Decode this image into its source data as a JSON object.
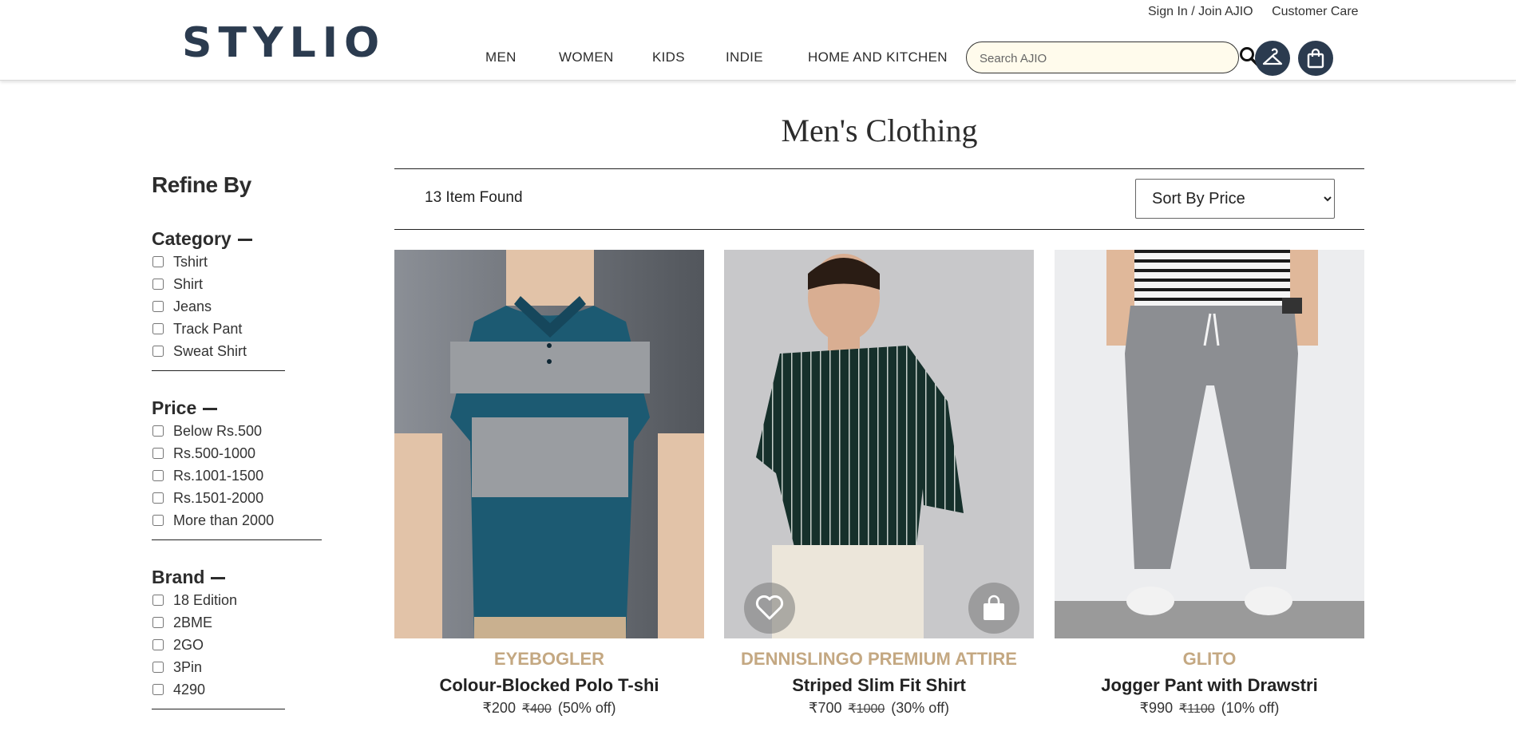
{
  "header": {
    "logo": "STYLIO",
    "top_links": [
      "Sign In / Join AJIO",
      "Customer Care"
    ],
    "nav": [
      "MEN",
      "WOMEN",
      "KIDS",
      "INDIE",
      "HOME AND KITCHEN"
    ],
    "search_placeholder": "Search AJIO",
    "icons": [
      "search-icon",
      "user-hanger-icon",
      "shopping-bag-icon"
    ],
    "brand_color": "#2b3b4f"
  },
  "sidebar": {
    "title": "Refine By",
    "groups": [
      {
        "title": "Category",
        "options": [
          "Tshirt",
          "Shirt",
          "Jeans",
          "Track Pant",
          "Sweat Shirt"
        ]
      },
      {
        "title": "Price",
        "options": [
          "Below Rs.500",
          "Rs.500-1000",
          "Rs.1001-1500",
          "Rs.1501-2000",
          "More than 2000"
        ]
      },
      {
        "title": "Brand",
        "options": [
          "18 Edition",
          "2BME",
          "2GO",
          "3Pin",
          "4290"
        ]
      }
    ]
  },
  "main": {
    "title": "Men's Clothing",
    "count": "13 Item Found",
    "sort_selected": "Sort By Price",
    "brand_color": "#c4a882",
    "products": [
      {
        "brand": "EYEBOGLER",
        "name": "Colour-Blocked Polo T-shi",
        "price": "₹200",
        "mrp": "₹400",
        "discount": "(50% off)"
      },
      {
        "brand": "DENNISLINGO PREMIUM ATTIRE",
        "name": "Striped Slim Fit Shirt",
        "price": "₹700",
        "mrp": "₹1000",
        "discount": "(30% off)"
      },
      {
        "brand": "GLITO",
        "name": "Jogger Pant with Drawstri",
        "price": "₹990",
        "mrp": "₹1100",
        "discount": "(10% off)"
      }
    ]
  }
}
